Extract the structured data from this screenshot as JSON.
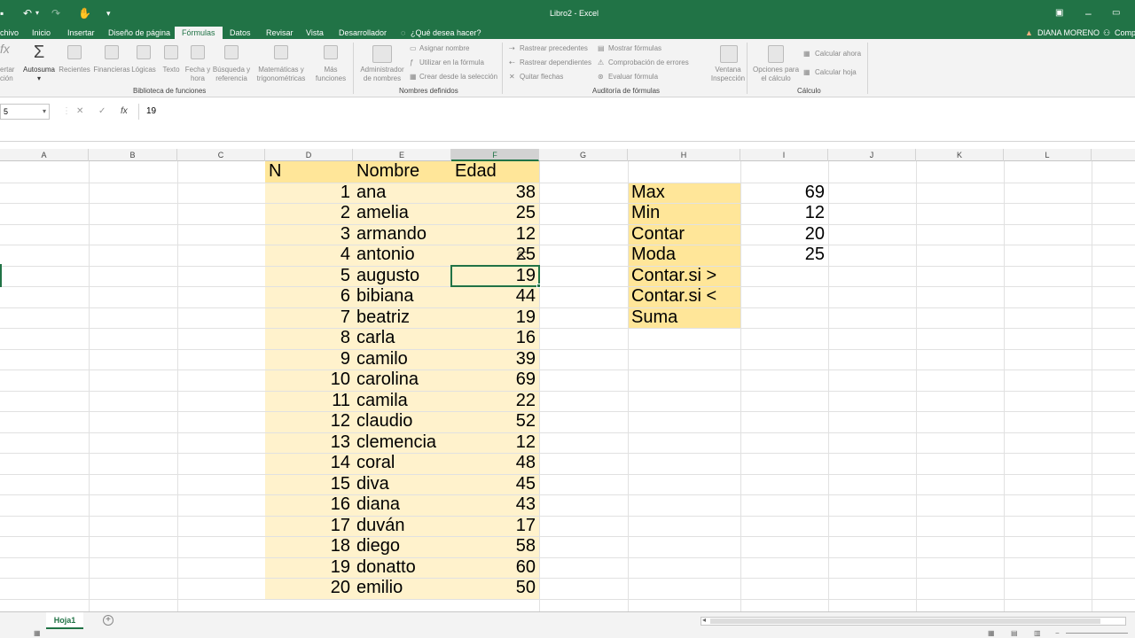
{
  "window": {
    "title": "Libro2 - Excel",
    "user": "DIANA MORENO",
    "share": "Comp",
    "minimize": "–",
    "restore": "▭"
  },
  "quick_access": {
    "undo": "↶",
    "redo": "↷",
    "touch": "✋",
    "more": "▾"
  },
  "tabs": [
    "chivo",
    "Inicio",
    "Insertar",
    "Diseño de página",
    "Fórmulas",
    "Datos",
    "Revisar",
    "Vista",
    "Desarrollador"
  ],
  "tell_me": "¿Qué desea hacer?",
  "ribbon": {
    "insert_fn": "ertar\nción",
    "autosum": "Autosuma",
    "recientes": "Recientes",
    "financieras": "Financieras",
    "logicas": "Lógicas",
    "texto": "Texto",
    "fecha": "Fecha y\nhora",
    "busqueda": "Búsqueda y\nreferencia",
    "matematicas": "Matemáticas y\ntrigonométricas",
    "mas": "Más\nfunciones",
    "biblioteca": "Biblioteca de funciones",
    "admin": "Administrador\nde nombres",
    "asignar": "Asignar nombre",
    "utilizar": "Utilizar en la fórmula",
    "crear": "Crear desde la selección",
    "nombres_def": "Nombres definidos",
    "rastrear_prec": "Rastrear precedentes",
    "rastrear_dep": "Rastrear dependientes",
    "quitar": "Quitar flechas",
    "mostrar": "Mostrar fórmulas",
    "comprobacion": "Comprobación de errores",
    "evaluar": "Evaluar fórmula",
    "auditoria": "Auditoría de fórmulas",
    "ventana": "Ventana\nInspección",
    "opciones": "Opciones para\nel cálculo",
    "calc_ahora": "Calcular ahora",
    "calc_hoja": "Calcular hoja",
    "calculo": "Cálculo"
  },
  "formula_bar": {
    "name_box": "5",
    "cancel": "✕",
    "enter": "✓",
    "fx": "fx",
    "value": "19"
  },
  "columns": [
    "A",
    "B",
    "C",
    "D",
    "E",
    "F",
    "G",
    "H",
    "I",
    "J",
    "K",
    "L"
  ],
  "table": {
    "headers": {
      "n": "N",
      "nombre": "Nombre",
      "edad": "Edad"
    },
    "rows": [
      {
        "n": "1",
        "nombre": "ana",
        "edad": "38"
      },
      {
        "n": "2",
        "nombre": "amelia",
        "edad": "25"
      },
      {
        "n": "3",
        "nombre": "armando",
        "edad": "12"
      },
      {
        "n": "4",
        "nombre": "antonio",
        "edad": "25"
      },
      {
        "n": "5",
        "nombre": "augusto",
        "edad": "19"
      },
      {
        "n": "6",
        "nombre": "bibiana",
        "edad": "44"
      },
      {
        "n": "7",
        "nombre": "beatriz",
        "edad": "19"
      },
      {
        "n": "8",
        "nombre": "carla",
        "edad": "16"
      },
      {
        "n": "9",
        "nombre": "camilo",
        "edad": "39"
      },
      {
        "n": "10",
        "nombre": "carolina",
        "edad": "69"
      },
      {
        "n": "11",
        "nombre": "camila",
        "edad": "22"
      },
      {
        "n": "12",
        "nombre": "claudio",
        "edad": "52"
      },
      {
        "n": "13",
        "nombre": "clemencia",
        "edad": "12"
      },
      {
        "n": "14",
        "nombre": "coral",
        "edad": "48"
      },
      {
        "n": "15",
        "nombre": "diva",
        "edad": "45"
      },
      {
        "n": "16",
        "nombre": "diana",
        "edad": "43"
      },
      {
        "n": "17",
        "nombre": "duván",
        "edad": "17"
      },
      {
        "n": "18",
        "nombre": "diego",
        "edad": "58"
      },
      {
        "n": "19",
        "nombre": "donatto",
        "edad": "60"
      },
      {
        "n": "20",
        "nombre": "emilio",
        "edad": "50"
      }
    ]
  },
  "stats": [
    {
      "label": "Max",
      "value": "69"
    },
    {
      "label": "Min",
      "value": "12"
    },
    {
      "label": "Contar",
      "value": "20"
    },
    {
      "label": "Moda",
      "value": "25"
    },
    {
      "label": "Contar.si >",
      "value": ""
    },
    {
      "label": "Contar.si <",
      "value": ""
    },
    {
      "label": "Suma",
      "value": ""
    }
  ],
  "sheet": {
    "name": "Hoja1",
    "add": "+"
  },
  "colors": {
    "excel_green": "#217346",
    "data_fill": "#fff2cc",
    "header_fill": "#ffe699"
  }
}
